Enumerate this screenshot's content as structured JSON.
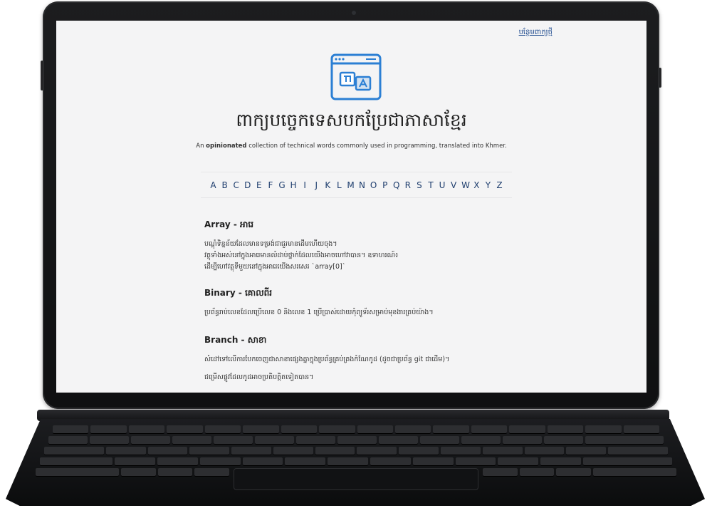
{
  "page": {
    "add_word_link": "បន្ថែមពាក្យថ្មី",
    "title": "ពាក្យបច្ចេកទេសបកប្រែជាភាសាខ្មែរ",
    "subtitle_prefix": "An ",
    "subtitle_bold": "opinionated",
    "subtitle_suffix": " collection of technical words commonly used in programming, translated into Khmer.",
    "alphabet": [
      "A",
      "B",
      "C",
      "D",
      "E",
      "F",
      "G",
      "H",
      "I",
      "J",
      "K",
      "L",
      "M",
      "N",
      "O",
      "P",
      "Q",
      "R",
      "S",
      "T",
      "U",
      "V",
      "W",
      "X",
      "Y",
      "Z"
    ]
  },
  "entries": [
    {
      "title": "Array - អារេ",
      "lines": [
        "បណ្តុំទិន្នន័យដែលមានទម្រង់ជាជួរមានដើមហើយចុង។",
        "វត្ថុទាំងអស់នៅក្នុងអារេមានលំដាប់ថ្នាក់ដែលយើងអាចហៅវាបាន។ ឧទាហរណ៍៖",
        "ដើម្បីហៅវត្ថុទីមួយនៅក្នុងអារេយើងសរសេរ `array[0]`"
      ]
    },
    {
      "title": "Binary - គោលពីរ",
      "lines": [
        "ប្រព័ន្ធរាប់លេខដែលប្រើលេខ 0 និងលេខ 1 ប្រើប្រាស់ដោយកុំព្យូទ័រសម្រាប់មុខងារគ្រប់យ៉ាង។"
      ]
    },
    {
      "title": "Branch - សាខា",
      "lines": [
        "សំដៅទៅលើការបែកចេញជាសាខាផ្សេងគ្នាក្នុងប្រព័ន្ធគ្រប់គ្រងកំណែកូដ (ដូចជាប្រព័ន្ធ git ជាដើម)។",
        "ជម្រើសផ្លូវដែលកូដអាចប្រតិបត្តិតទៀតបាន។"
      ]
    }
  ],
  "colors": {
    "accent": "#2b7fd4",
    "link": "#1f4b8f",
    "screen_bg": "#f4f4f5",
    "device": "#141517"
  },
  "icons": {
    "logo": "translate-browser-icon"
  }
}
